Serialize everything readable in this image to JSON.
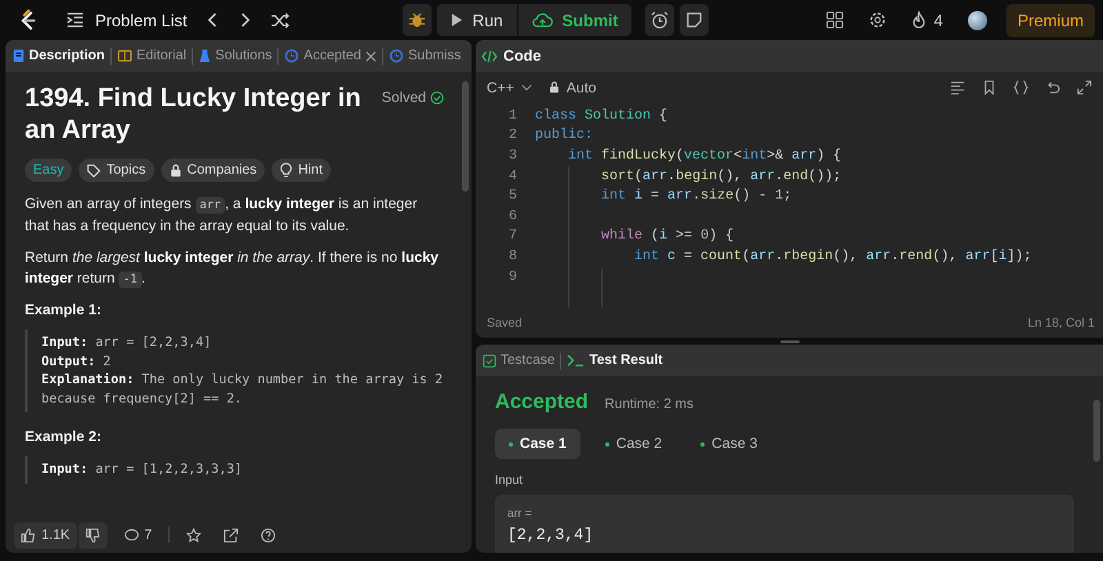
{
  "topbar": {
    "problem_list": "Problem List",
    "run": "Run",
    "submit": "Submit",
    "streak": "4",
    "premium": "Premium"
  },
  "description_tabs": [
    {
      "label": "Description",
      "kind": "description",
      "selected": true,
      "closable": false
    },
    {
      "label": "Editorial",
      "kind": "editorial",
      "selected": false,
      "closable": false
    },
    {
      "label": "Solutions",
      "kind": "solutions",
      "selected": false,
      "closable": false
    },
    {
      "label": "Accepted",
      "kind": "history",
      "selected": false,
      "closable": true
    },
    {
      "label": "Submiss",
      "kind": "history",
      "selected": false,
      "closable": false
    }
  ],
  "problem": {
    "title": "1394. Find Lucky Integer in an Array",
    "status": "Solved",
    "tags": [
      {
        "label": "Easy",
        "kind": "difficulty"
      },
      {
        "label": "Topics",
        "kind": "topics"
      },
      {
        "label": "Companies",
        "kind": "companies"
      },
      {
        "label": "Hint",
        "kind": "hint"
      }
    ],
    "paragraphs": [
      [
        {
          "kind": "text",
          "text": "Given an array of integers "
        },
        {
          "kind": "code",
          "text": "arr"
        },
        {
          "kind": "text",
          "text": ", a **lucky integer** is an integer that has a frequency in the array equal to its value."
        }
      ],
      [
        {
          "kind": "text",
          "text": "Return *the largest* **lucky integer** *in the array*. If there is no **lucky integer** return "
        },
        {
          "kind": "code",
          "text": "-1"
        },
        {
          "kind": "text",
          "text": "."
        }
      ]
    ],
    "examples": [
      {
        "title": "Example 1:",
        "lines": [
          {
            "label": "Input:",
            "value": "arr = [2,2,3,4]"
          },
          {
            "label": "Output:",
            "value": "2"
          },
          {
            "label": "Explanation:",
            "value": "The only lucky number in the array is 2 because frequency[2] == 2."
          }
        ]
      },
      {
        "title": "Example 2:",
        "lines": [
          {
            "label": "Input:",
            "value": "arr = [1,2,2,3,3,3]"
          }
        ]
      }
    ]
  },
  "footer": {
    "likes": "1.1K",
    "comments": "7"
  },
  "code": {
    "tab": "Code",
    "language": "C++",
    "mode": "Auto",
    "lines": [
      {
        "number": "1",
        "tokens": [
          {
            "kind": "keyword",
            "text": "class"
          },
          {
            "kind": "type",
            "text": " Solution"
          },
          {
            "kind": "plain",
            "text": " {"
          }
        ]
      },
      {
        "number": "2",
        "tokens": [
          {
            "kind": "keyword",
            "text": "public:"
          }
        ]
      },
      {
        "number": "3",
        "tokens": [
          {
            "kind": "keyword",
            "text": "    int"
          },
          {
            "kind": "function",
            "text": " findLucky"
          },
          {
            "kind": "plain",
            "text": "("
          },
          {
            "kind": "type",
            "text": "vector"
          },
          {
            "kind": "plain",
            "text": "<"
          },
          {
            "kind": "keyword",
            "text": "int"
          },
          {
            "kind": "plain",
            "text": ">& "
          },
          {
            "kind": "variable",
            "text": "arr"
          },
          {
            "kind": "plain",
            "text": ") {"
          }
        ]
      },
      {
        "number": "4",
        "tokens": [
          {
            "kind": "function",
            "text": "        sort"
          },
          {
            "kind": "plain",
            "text": "("
          },
          {
            "kind": "variable",
            "text": "arr"
          },
          {
            "kind": "plain",
            "text": "."
          },
          {
            "kind": "function",
            "text": "begin"
          },
          {
            "kind": "plain",
            "text": "(), "
          },
          {
            "kind": "variable",
            "text": "arr"
          },
          {
            "kind": "plain",
            "text": "."
          },
          {
            "kind": "function",
            "text": "end"
          },
          {
            "kind": "plain",
            "text": "());"
          }
        ]
      },
      {
        "number": "5",
        "tokens": [
          {
            "kind": "keyword",
            "text": "        int"
          },
          {
            "kind": "variable",
            "text": " i"
          },
          {
            "kind": "plain",
            "text": " = "
          },
          {
            "kind": "variable",
            "text": "arr"
          },
          {
            "kind": "plain",
            "text": "."
          },
          {
            "kind": "function",
            "text": "size"
          },
          {
            "kind": "plain",
            "text": "() - "
          },
          {
            "kind": "number",
            "text": "1"
          },
          {
            "kind": "plain",
            "text": ";"
          }
        ]
      },
      {
        "number": "6"
      },
      {
        "number": "7",
        "tokens": [
          {
            "kind": "control",
            "text": "        while"
          },
          {
            "kind": "plain",
            "text": " ("
          },
          {
            "kind": "variable",
            "text": "i"
          },
          {
            "kind": "plain",
            "text": " >= "
          },
          {
            "kind": "number",
            "text": "0"
          },
          {
            "kind": "plain",
            "text": ") {"
          }
        ]
      },
      {
        "number": "8",
        "tokens": [
          {
            "kind": "keyword",
            "text": "            int"
          },
          {
            "kind": "variable",
            "text": " c"
          },
          {
            "kind": "plain",
            "text": " = "
          },
          {
            "kind": "function",
            "text": "count"
          },
          {
            "kind": "plain",
            "text": "("
          },
          {
            "kind": "variable",
            "text": "arr"
          },
          {
            "kind": "plain",
            "text": "."
          },
          {
            "kind": "function",
            "text": "rbegin"
          },
          {
            "kind": "plain",
            "text": "(), "
          },
          {
            "kind": "variable",
            "text": "arr"
          },
          {
            "kind": "plain",
            "text": "."
          },
          {
            "kind": "function",
            "text": "rend"
          },
          {
            "kind": "plain",
            "text": "(), "
          },
          {
            "kind": "variable",
            "text": "arr"
          },
          {
            "kind": "plain",
            "text": "["
          },
          {
            "kind": "variable",
            "text": "i"
          },
          {
            "kind": "plain",
            "text": "]);"
          }
        ]
      },
      {
        "number": "9"
      }
    ],
    "status": "Saved",
    "cursor": "Ln 18, Col 1"
  },
  "result": {
    "tabs": [
      {
        "label": "Testcase",
        "kind": "testcase",
        "selected": false
      },
      {
        "label": "Test Result",
        "kind": "terminal",
        "selected": true
      }
    ],
    "verdict": "Accepted",
    "runtime": "Runtime: 2 ms",
    "cases": [
      {
        "label": "Case 1",
        "selected": true,
        "passed": true
      },
      {
        "label": "Case 2",
        "selected": false,
        "passed": true
      },
      {
        "label": "Case 3",
        "selected": false,
        "passed": true
      }
    ],
    "input_label": "Input",
    "inputs": [
      {
        "name": "arr =",
        "value": "[2,2,3,4]"
      }
    ]
  }
}
